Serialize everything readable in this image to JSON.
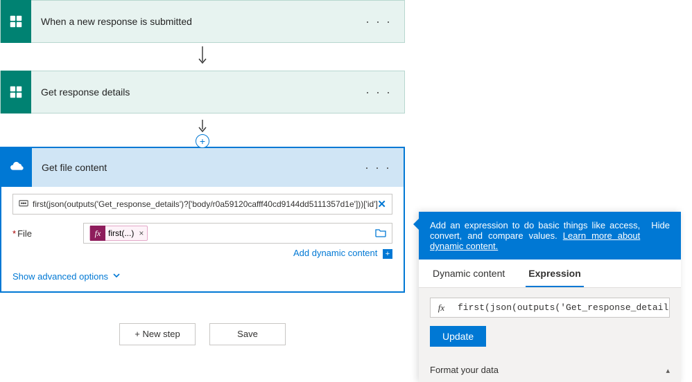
{
  "steps": [
    {
      "title": "When a new response is submitted"
    },
    {
      "title": "Get response details"
    }
  ],
  "expanded": {
    "title": "Get file content",
    "rename_text": "first(json(outputs('Get_response_details')?['body/r0a59120cafff40cd9144dd5111357d1e']))['id']",
    "param_label": "File",
    "token_label": "first(...)",
    "add_dc": "Add dynamic content",
    "show_adv": "Show advanced options"
  },
  "footer": {
    "new_step": "+ New step",
    "save": "Save"
  },
  "flyout": {
    "instruction_prefix": "Add an expression to do basic things like access, convert, and compare values. ",
    "learn_more": "Learn more about dynamic content.",
    "hide": "Hide",
    "tab_dc": "Dynamic content",
    "tab_expr": "Expression",
    "fx_value": "first(json(outputs('Get_response_details",
    "fx_icon": "fx",
    "update": "Update",
    "format": "Format your data"
  }
}
